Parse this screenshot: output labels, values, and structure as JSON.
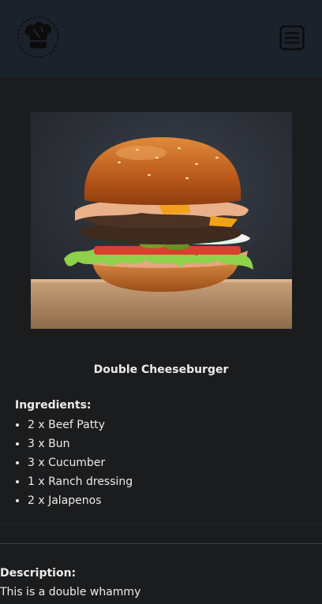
{
  "header": {
    "logo_icon": "chef-hat-icon",
    "menu_icon": "hamburger-menu-icon",
    "background_color": "#1c222c"
  },
  "recipe": {
    "image_subject": "double cheeseburger photo",
    "title": "Double Cheeseburger",
    "ingredients_heading": "Ingredients:",
    "ingredients": [
      "2 x Beef Patty",
      "3 x Bun",
      "3 x Cucumber",
      "1 x Ranch dressing",
      "2 x Jalapenos"
    ],
    "description_heading": "Description:",
    "description": "This is a double whammy"
  },
  "colors": {
    "page_background": "#1b1c1e",
    "text": "#ececec",
    "divider": "#3d4046"
  }
}
